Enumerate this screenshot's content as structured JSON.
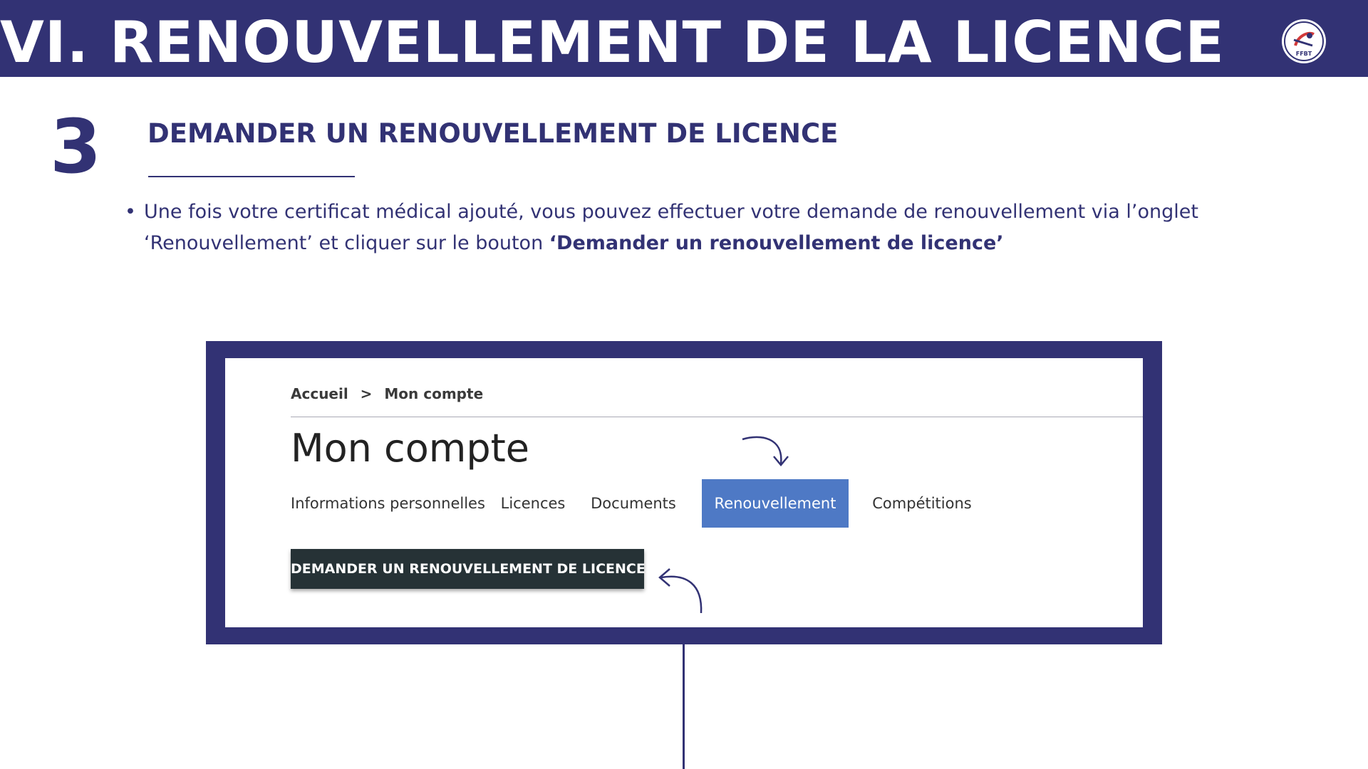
{
  "header": {
    "title": "VI. RENOUVELLEMENT DE LA LICENCE",
    "logo_icon": "ffbt-logo-icon",
    "logo_text": "FFBT"
  },
  "step": {
    "number": "3",
    "title": "DEMANDER UN RENOUVELLEMENT DE LICENCE"
  },
  "instruction": {
    "text_before": "Une fois votre certificat médical ajouté, vous pouvez effectuer votre demande de renouvellement via l’onglet ‘Renouvellement’ et cliquer sur le bouton ",
    "text_bold": "‘Demander un renouvellement de licence’"
  },
  "screenshot": {
    "breadcrumb": [
      "Accueil",
      ">",
      "Mon compte"
    ],
    "page_title": "Mon compte",
    "tabs": [
      {
        "label": "Informations personnelles",
        "active": false
      },
      {
        "label": "Licences",
        "active": false
      },
      {
        "label": "Documents",
        "active": false
      },
      {
        "label": "Renouvellement",
        "active": true
      },
      {
        "label": "Compétitions",
        "active": false
      }
    ],
    "cta_label": "DEMANDER UN RENOUVELLEMENT DE LICENCE"
  },
  "colors": {
    "brand_navy": "#323274",
    "tab_active_blue": "#4e79c5",
    "button_dark": "#263236"
  }
}
